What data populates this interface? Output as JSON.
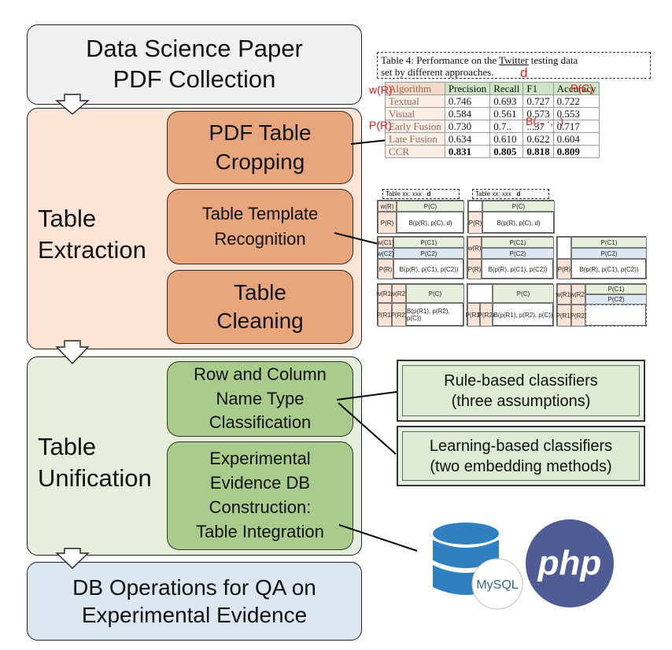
{
  "pipeline": {
    "source": "Data Science Paper\nPDF Collection",
    "extraction": {
      "label": "Table\nExtraction",
      "steps": [
        "PDF Table\nCropping",
        "Table Template\nRecognition",
        "Table\nCleaning"
      ]
    },
    "unification": {
      "label": "Table\nUnification",
      "steps": [
        "Row and Column\nName Type\nClassification",
        "Experimental\nEvidence DB\nConstruction:\nTable Integration"
      ]
    },
    "operations": "DB Operations for QA on\nExperimental Evidence"
  },
  "classifiers": [
    "Rule-based classifiers\n(three assumptions)",
    "Learning-based classifiers\n(two embedding methods)"
  ],
  "example_table": {
    "caption_prefix": "Table 4:  Performance on the ",
    "caption_underlined": "Twitter",
    "caption_suffix": " testing data",
    "caption_line2": "set by different approaches.",
    "columns": [
      "Algorithm",
      "Precision",
      "Recall",
      "F1",
      "Accuracy"
    ],
    "rows": [
      [
        "Textual",
        "0.746",
        "0.693",
        "0.727",
        "0.722"
      ],
      [
        "Visual",
        "0.584",
        "0.561",
        "0.573",
        "0.553"
      ],
      [
        "Early Fusion",
        "0.730",
        "0.7..",
        "...37",
        "0.717"
      ],
      [
        "Late Fusion",
        "0.634",
        "0.610",
        "0.622",
        "0.604"
      ],
      [
        "CCR",
        "0.831",
        "0.805",
        "0.818",
        "0.809"
      ]
    ],
    "bold_row": "CCR"
  },
  "annotations": {
    "d": "d",
    "wR": "w(R)",
    "pR": "P(R)",
    "pC": "P(C)",
    "b": "B(·, ·, ·)"
  },
  "templates": {
    "caption_hint": "Table xx: xxx",
    "d": "d",
    "w_r": "w(R)",
    "p_r": "P(R)",
    "p_c": "P(C)",
    "p_c1": "P(C1)",
    "p_c2": "P(C2)",
    "w_c1": "w(C1)",
    "w_c2": "w(C2)",
    "w_r1": "w(R1)",
    "w_r2": "w(R2)",
    "p_r1": "P(R1)",
    "p_r2": "P(R2)",
    "b_simple": "B(p(R), p(C), d)",
    "b_col": "B(p(R), p(C1), p(C2))",
    "b_row": "B(p(R1), p(R2), p(C))"
  },
  "logos": {
    "mysql": "MySQL",
    "php": "php"
  },
  "colors": {
    "extraction_panel": "#fbe4d6",
    "extraction_step": "#e8a67d",
    "unification_panel": "#e6eedc",
    "unification_step": "#a9cc8d",
    "operations": "#dde7f2",
    "annotation_red": "#e31b1b"
  }
}
